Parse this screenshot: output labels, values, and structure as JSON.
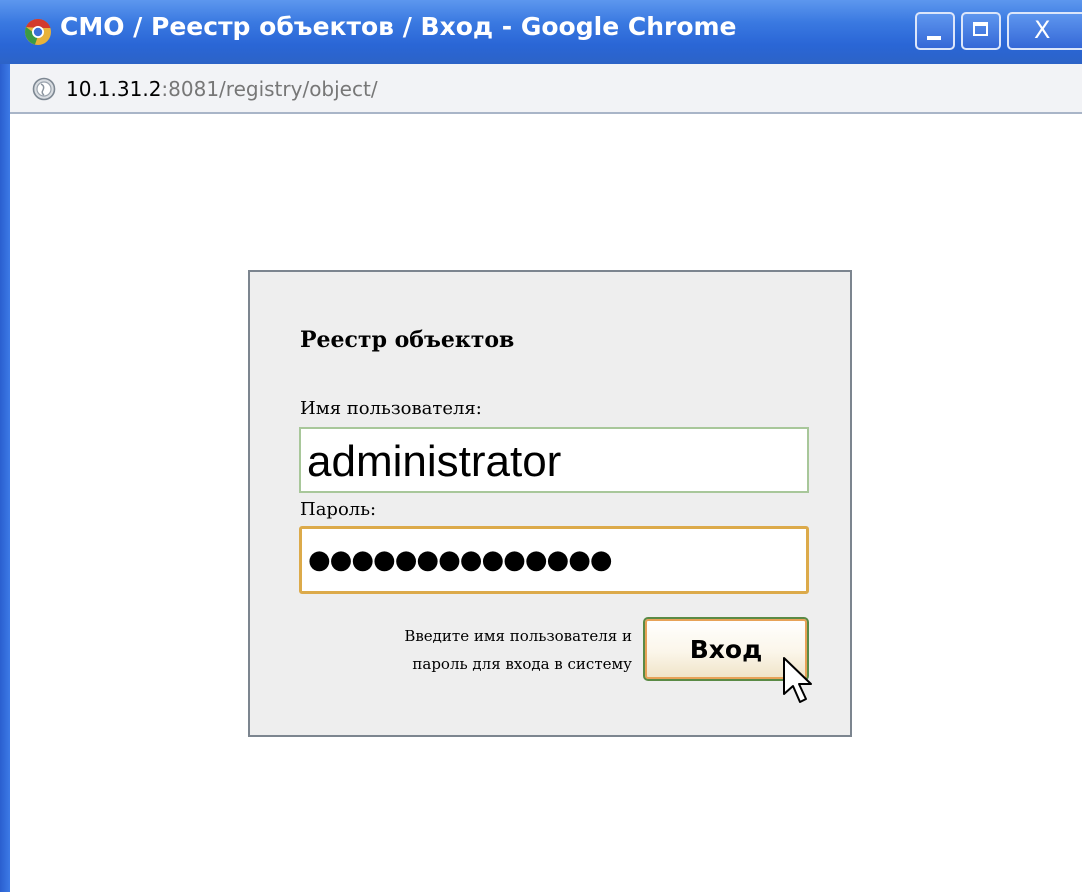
{
  "window": {
    "title": "СМО / Реестр объектов / Вход - Google Chrome",
    "close_glyph": "X"
  },
  "address": {
    "host": "10.1.31.2",
    "rest": ":8081/registry/object/"
  },
  "login": {
    "title": "Реестр объектов",
    "username_label": "Имя пользователя:",
    "username_value": "administrator",
    "password_label": "Пароль:",
    "password_mask": "●●●●●●●●●●●●●●",
    "hint_line1": "Введите имя пользователя и",
    "hint_line2": "пароль для входа в систему",
    "submit_label": "Вход"
  },
  "icons": {
    "app": "chrome-logo-icon",
    "address": "globe-icon",
    "cursor": "mouse-pointer-icon"
  }
}
